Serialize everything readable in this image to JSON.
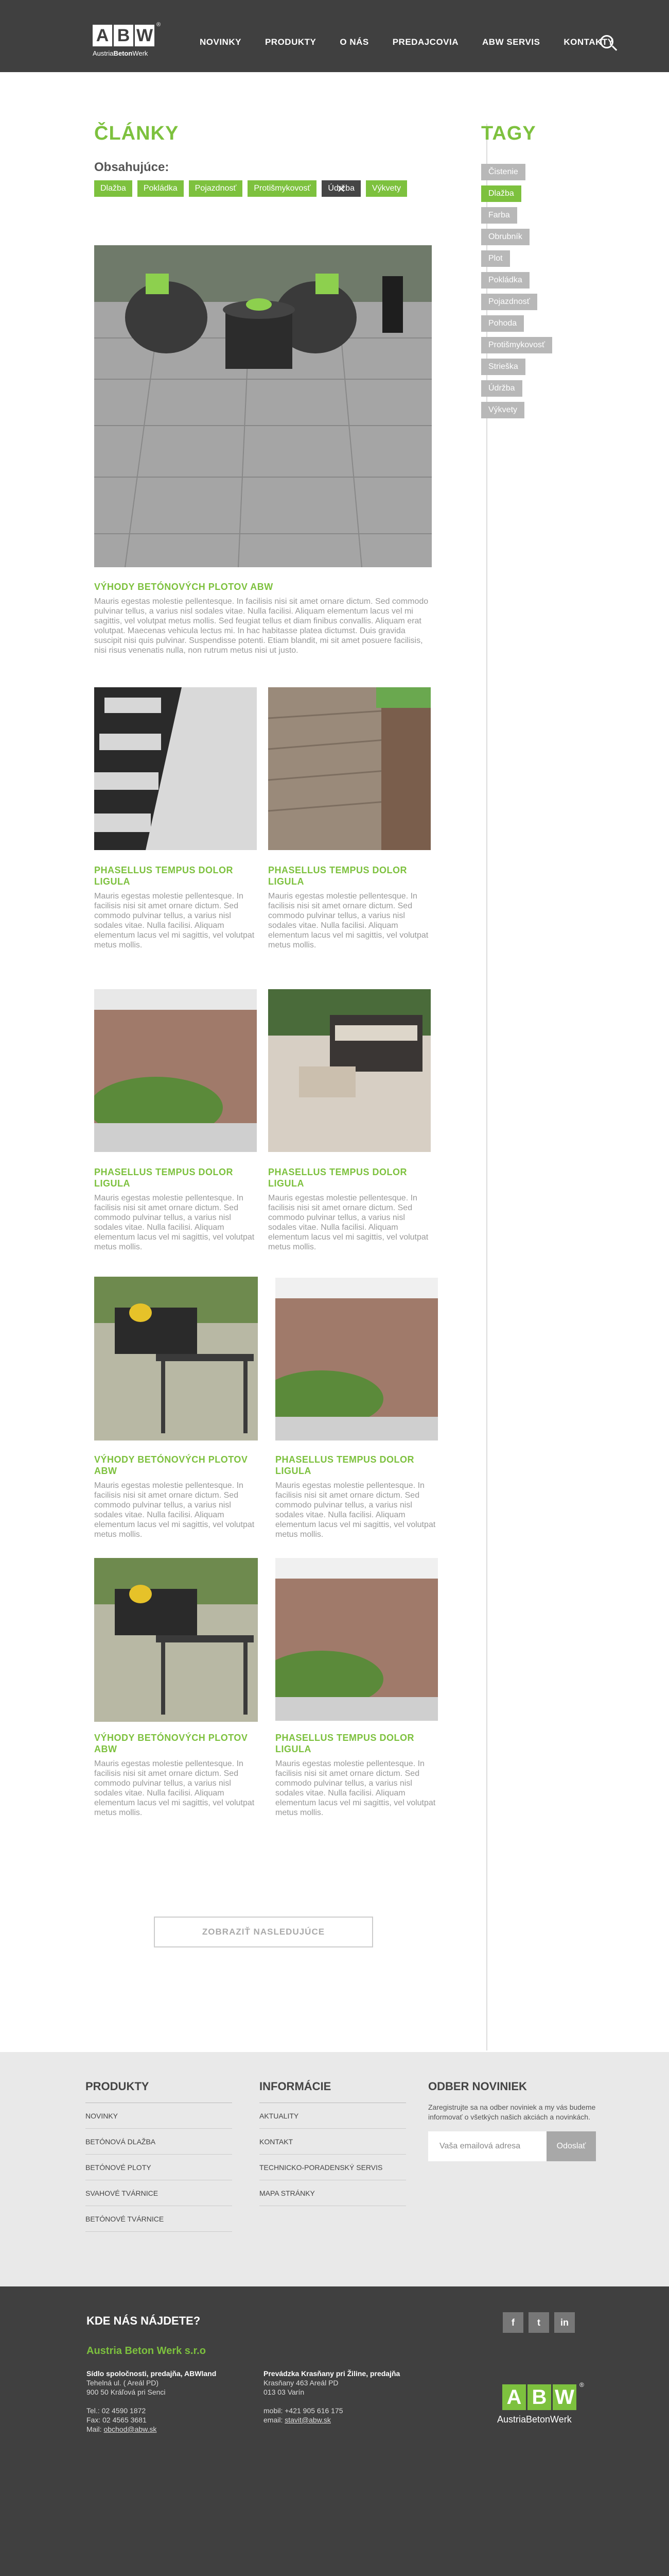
{
  "header": {
    "logo_letters": [
      "A",
      "B",
      "W"
    ],
    "logo_sub_pre": "Austria",
    "logo_sub_bold": "Beton",
    "logo_sub_post": "Werk",
    "logo_reg": "®",
    "nav": [
      "NOVINKY",
      "PRODUKTY",
      "O NÁS",
      "PREDAJCOVIA",
      "ABW SERVIS",
      "KONTAKTY"
    ]
  },
  "main": {
    "title": "ČLÁNKY",
    "contains_label": "Obsahujúce:",
    "filters": [
      "Dlažba",
      "Pokládka",
      "Pojazdnosť",
      "Protišmykovosť",
      "Údržba",
      "Výkvety"
    ],
    "featured": {
      "title": "VÝHODY BETÓNOVÝCH PLOTOV ABW",
      "text": "Mauris egestas molestie pellentesque. In facilisis nisi sit amet ornare dictum. Sed commodo pulvinar tellus, a varius nisl sodales vitae. Nulla facilisi. Aliquam elementum lacus vel mi sagittis, vel volutpat metus mollis. Sed feugiat tellus et diam finibus convallis. Aliquam erat volutpat. Maecenas vehicula lectus mi. In hac habitasse platea dictumst. Duis gravida suscipit nisi quis pulvinar. Suspendisse potenti. Etiam blandit, mi sit amet posuere facilisis, nisi risus venenatis nulla, non rutrum metus nisi ut justo."
    },
    "articles": [
      {
        "title": "PHASELLUS TEMPUS DOLOR LIGULA",
        "text": "Mauris egestas molestie pellentesque. In facilisis nisi sit amet ornare dictum. Sed commodo pulvinar tellus, a varius nisl sodales vitae. Nulla facilisi. Aliquam elementum lacus vel mi sagittis, vel volutpat metus mollis."
      },
      {
        "title": "PHASELLUS TEMPUS DOLOR LIGULA",
        "text": "Mauris egestas molestie pellentesque. In facilisis nisi sit amet ornare dictum. Sed commodo pulvinar tellus, a varius nisl sodales vitae. Nulla facilisi. Aliquam elementum lacus vel mi sagittis, vel volutpat metus mollis."
      },
      {
        "title": "PHASELLUS TEMPUS DOLOR LIGULA",
        "text": "Mauris egestas molestie pellentesque. In facilisis nisi sit amet ornare dictum. Sed commodo pulvinar tellus, a varius nisl sodales vitae. Nulla facilisi. Aliquam elementum lacus vel mi sagittis, vel volutpat metus mollis."
      },
      {
        "title": "PHASELLUS TEMPUS DOLOR LIGULA",
        "text": "Mauris egestas molestie pellentesque. In facilisis nisi sit amet ornare dictum. Sed commodo pulvinar tellus, a varius nisl sodales vitae. Nulla facilisi. Aliquam elementum lacus vel mi sagittis, vel volutpat metus mollis."
      },
      {
        "title": "VÝHODY BETÓNOVÝCH PLOTOV ABW",
        "text": "Mauris egestas molestie pellentesque. In facilisis nisi sit amet ornare dictum. Sed commodo pulvinar tellus, a varius nisl sodales vitae. Nulla facilisi. Aliquam elementum lacus vel mi sagittis, vel volutpat metus mollis."
      },
      {
        "title": "PHASELLUS TEMPUS DOLOR LIGULA",
        "text": "Mauris egestas molestie pellentesque. In facilisis nisi sit amet ornare dictum. Sed commodo pulvinar tellus, a varius nisl sodales vitae. Nulla facilisi. Aliquam elementum lacus vel mi sagittis, vel volutpat metus mollis."
      },
      {
        "title": "VÝHODY BETÓNOVÝCH PLOTOV ABW",
        "text": "Mauris egestas molestie pellentesque. In facilisis nisi sit amet ornare dictum. Sed commodo pulvinar tellus, a varius nisl sodales vitae. Nulla facilisi. Aliquam elementum lacus vel mi sagittis, vel volutpat metus mollis."
      },
      {
        "title": "PHASELLUS TEMPUS DOLOR LIGULA",
        "text": "Mauris egestas molestie pellentesque. In facilisis nisi sit amet ornare dictum. Sed commodo pulvinar tellus, a varius nisl sodales vitae. Nulla facilisi. Aliquam elementum lacus vel mi sagittis, vel volutpat metus mollis."
      }
    ],
    "more_button": "ZOBRAZIŤ NASLEDUJÚCE"
  },
  "sidebar": {
    "title": "TAGY",
    "tags": [
      "Čistenie",
      "Dlažba",
      "Farba",
      "Obrubník",
      "Plot",
      "Pokládka",
      "Pojazdnosť",
      "Pohoda",
      "Protišmykovosť",
      "Strieška",
      "Údržba",
      "Výkvety"
    ]
  },
  "footer": {
    "products_title": "PRODUKTY",
    "products": [
      "NOVINKY",
      "BETÓNOVÁ DLAŽBA",
      "BETÓNOVÉ PLOTY",
      "SVAHOVÉ TVÁRNICE",
      "BETÓNOVÉ TVÁRNICE"
    ],
    "info_title": "INFORMÁCIE",
    "info": [
      "AKTUALITY",
      "KONTAKT",
      "TECHNICKO-PORADENSKÝ SERVIS",
      "MAPA STRÁNKY"
    ],
    "newsletter_title": "ODBER NOVINIEK",
    "newsletter_text": "Zaregistrujte sa na odber noviniek a my vás budeme informovať o všetkých našich akciách a novinkách.",
    "email_placeholder": "Vaša emailová adresa",
    "send_label": "Odoslať",
    "where_title": "KDE NÁS NÁJDETE?",
    "company": "Austria Beton Werk s.r.o",
    "addr1": {
      "head": "Sídlo spoločnosti, predajňa, ABWland",
      "l1": "Tehelná ul. ( Areál PD)",
      "l2": "900 50 Kráľová pri Senci",
      "tel": "Tel.: 02 4590 1872",
      "fax": "Fax: 02 4565 3681",
      "mail_label": "Mail: ",
      "mail": "obchod@abw.sk"
    },
    "addr2": {
      "head": "Prevádzka Krasňany pri Žiline, predajňa",
      "l1": "Krasňany 463 Areál PD",
      "l2": "013 03 Varín",
      "mob": "mobil: +421 905 616 175",
      "mail_label": "email: ",
      "mail": "stavit@abw.sk"
    },
    "social": [
      "f",
      "t",
      "in"
    ],
    "logo_letters": [
      "A",
      "B",
      "W"
    ],
    "logo_sub": "AustriaBetonWerk",
    "logo_reg": "®"
  },
  "colors": {
    "accent": "#7dc13e",
    "header": "#404040",
    "footer_light": "#e9e9e9"
  }
}
